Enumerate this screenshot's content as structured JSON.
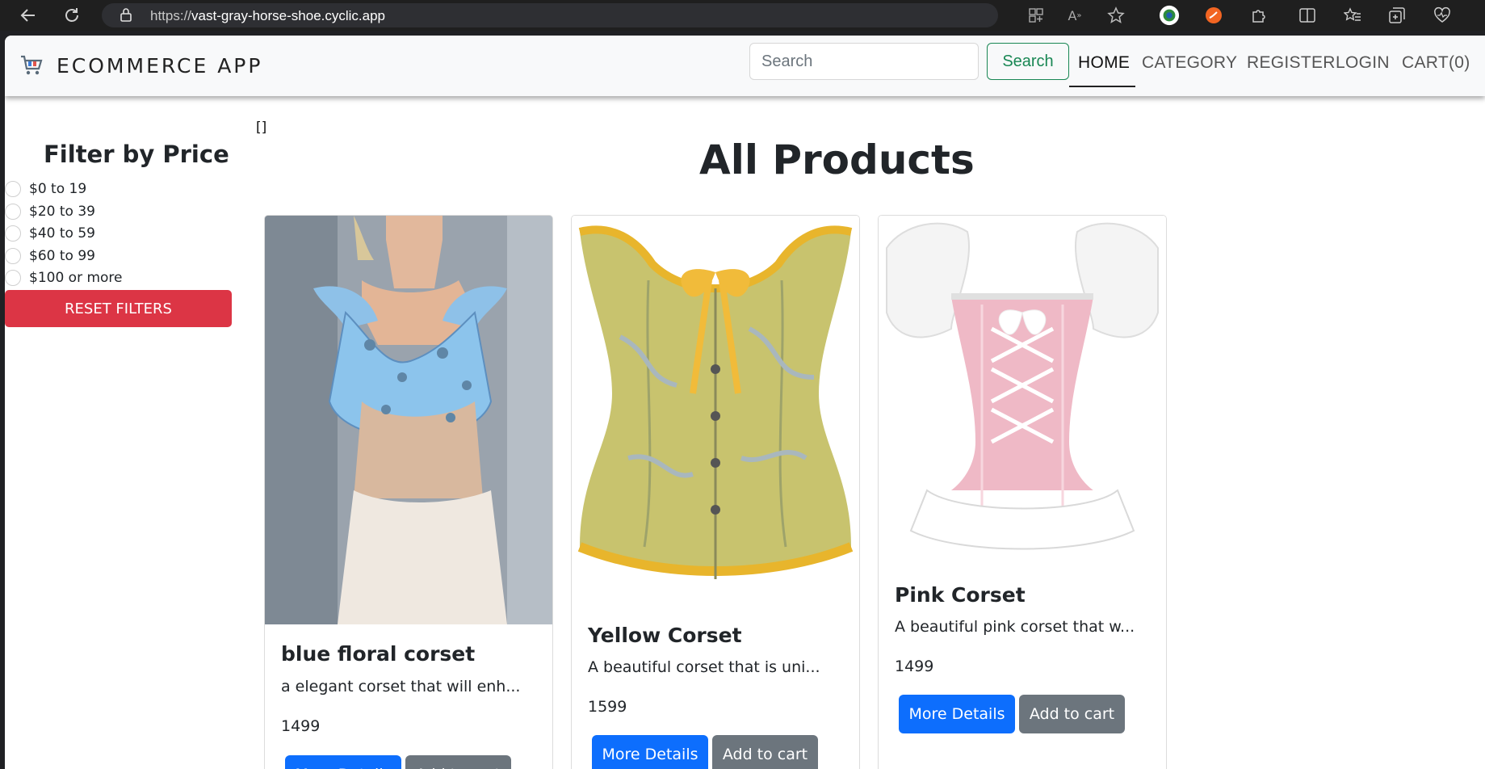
{
  "browser": {
    "url_prefix": "https://",
    "url_host": "vast-gray-horse-shoe.cyclic.app"
  },
  "navbar": {
    "brand": "ECOMMERCE APP",
    "search_placeholder": "Search",
    "search_button": "Search",
    "links": [
      "HOME",
      "CATEGORY",
      "REGISTER",
      "LOGIN",
      "CART(0)"
    ]
  },
  "debug_text": "[]",
  "filters": {
    "title": "Filter by Price",
    "options": [
      "$0 to 19",
      "$20 to 39",
      "$40 to 59",
      "$60 to 99",
      "$100 or more"
    ],
    "reset_button": "RESET FILTERS"
  },
  "main": {
    "title": "All Products",
    "products": [
      {
        "name": "blue floral corset",
        "description": "a elegant corset that will enh...",
        "price": "1499",
        "details_button": "More Details",
        "cart_button": "Add to cart"
      },
      {
        "name": "Yellow Corset",
        "description": "A beautiful corset that is uni...",
        "price": "1599",
        "details_button": "More Details",
        "cart_button": "Add to cart"
      },
      {
        "name": "Pink Corset",
        "description": "A beautiful pink corset that w...",
        "price": "1499",
        "details_button": "More Details",
        "cart_button": "Add to cart"
      }
    ]
  },
  "colors": {
    "primary": "#0d6efd",
    "secondary": "#6c757d",
    "danger": "#dc3545",
    "success": "#198754"
  }
}
